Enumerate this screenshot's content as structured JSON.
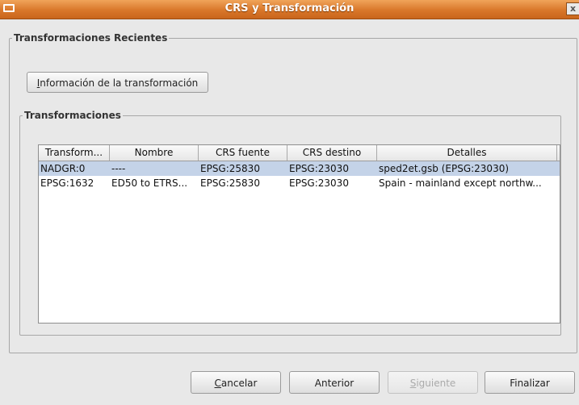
{
  "window": {
    "title": "CRS y Transformación",
    "close_glyph": "x"
  },
  "recent": {
    "legend": "Transformaciones Recientes",
    "info_button": {
      "mnemonic": "I",
      "rest": "nformación de la transformación"
    },
    "transformations": {
      "legend": "Transformaciones",
      "columns": [
        "Transform...",
        "Nombre",
        "CRS fuente",
        "CRS destino",
        "Detalles"
      ],
      "rows": [
        [
          "NADGR:0",
          "----",
          "EPSG:25830",
          "EPSG:23030",
          "sped2et.gsb (EPSG:23030)"
        ],
        [
          "EPSG:1632",
          "ED50 to ETRS...",
          "EPSG:25830",
          "EPSG:23030",
          "Spain - mainland except northw..."
        ]
      ],
      "selected_row": 0
    }
  },
  "footer": {
    "cancel": {
      "mnemonic": "C",
      "rest": "ancelar"
    },
    "previous": "Anterior",
    "next": {
      "mnemonic": "S",
      "rest": "iguiente",
      "enabled": false
    },
    "finish": "Finalizar"
  },
  "colors": {
    "titlebar": "#d9772a",
    "selection": "#c4d3e8",
    "background": "#e8e8e8"
  },
  "icons": {
    "window_menu": "window-menu-icon",
    "close": "close-icon"
  }
}
